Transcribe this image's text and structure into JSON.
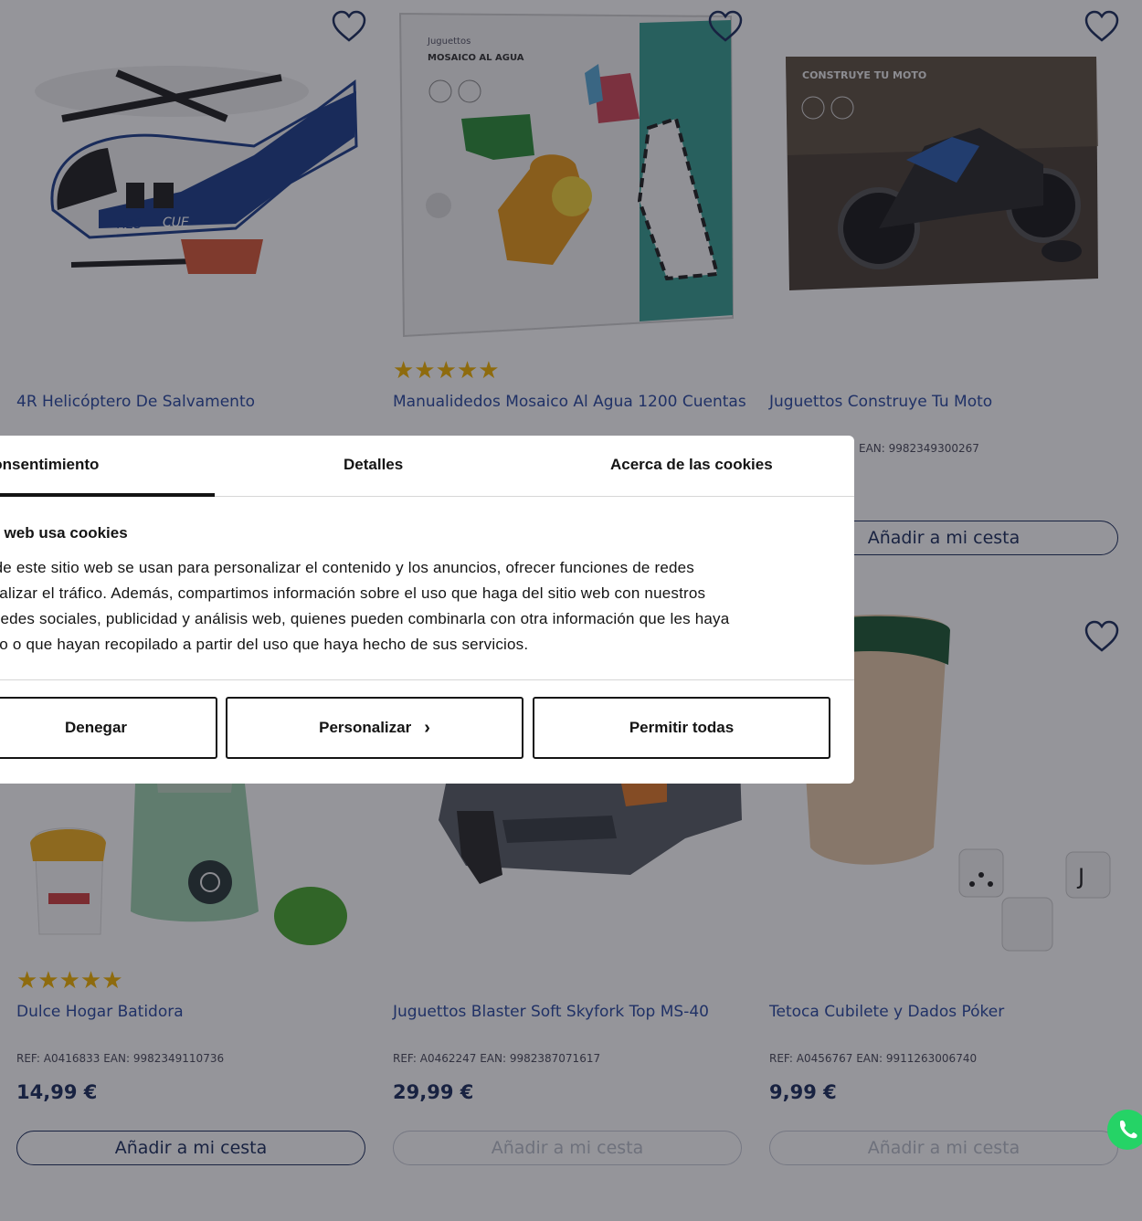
{
  "products": [
    {
      "name": "4R Helicóptero De Salvamento",
      "ref": "",
      "price": "",
      "stars": "",
      "cart": "",
      "image": "helicopter"
    },
    {
      "name": "Manualidedos Mosaico Al Agua 1200 Cuentas",
      "ref": "",
      "price": "",
      "stars": "★★★★★",
      "cart": "",
      "image": "mosaic-kit",
      "box_brand": "Juguettos",
      "box_title": "MOSAICO AL AGUA"
    },
    {
      "name": "Juguettos Construye Tu Moto",
      "ref": "EAN: 9982349300267",
      "price": "",
      "stars": "",
      "cart": "Añadir a mi cesta",
      "image": "moto-kit",
      "box_title": "CONSTRUYE TU MOTO"
    },
    {
      "name": "Dulce Hogar Batidora",
      "ref": "REF: A0416833 EAN: 9982349110736",
      "price": "14,99 €",
      "stars": "★★★★★",
      "cart": "Añadir a mi cesta",
      "image": "blender"
    },
    {
      "name": "Juguettos Blaster Soft Skyfork Top MS-40",
      "ref": "REF: A0462247 EAN: 9982387071617",
      "price": "29,99 €",
      "stars": "",
      "cart": "Añadir a mi cesta",
      "image": "blaster"
    },
    {
      "name": "Tetoca Cubilete y Dados Póker",
      "ref": "REF: A0456767 EAN: 9911263006740",
      "price": "9,99 €",
      "stars": "",
      "cart": "Añadir a mi cesta",
      "image": "dice-cup"
    }
  ],
  "cookie_dialog": {
    "tabs": [
      "Consentimiento",
      "Detalles",
      "Acerca de las cookies"
    ],
    "title": "na web usa cookies",
    "body_lines": [
      "s de este sitio web se usan para personalizar el contenido y los anuncios, ofrecer funciones de redes",
      "analizar el tráfico. Además, compartimos información sobre el uso que haga del sitio web con nuestros",
      "e redes sociales, publicidad y análisis web, quienes pueden combinarla con otra información que les haya",
      "ado o que hayan recopilado a partir del uso que haya hecho de sus servicios."
    ],
    "buttons": {
      "deny": "Denegar",
      "customize": "Personalizar",
      "allow_all": "Permitir todas"
    }
  },
  "colors": {
    "brand_navy": "#1d2f5e",
    "link_blue": "#2a4aa0",
    "star": "#f2b300",
    "whatsapp": "#25d366"
  }
}
